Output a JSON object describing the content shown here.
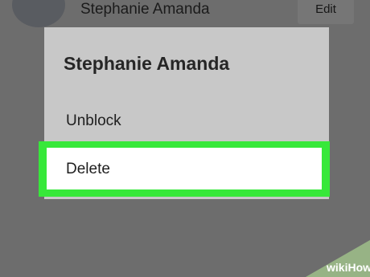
{
  "contact": {
    "name": "Stephanie Amanda",
    "edit_label": "Edit"
  },
  "dialog": {
    "title": "Stephanie Amanda",
    "items": [
      {
        "label": "Unblock"
      },
      {
        "label": "Delete"
      }
    ]
  },
  "highlight_color": "#37e83a",
  "watermark": {
    "text": "wikiHow"
  }
}
